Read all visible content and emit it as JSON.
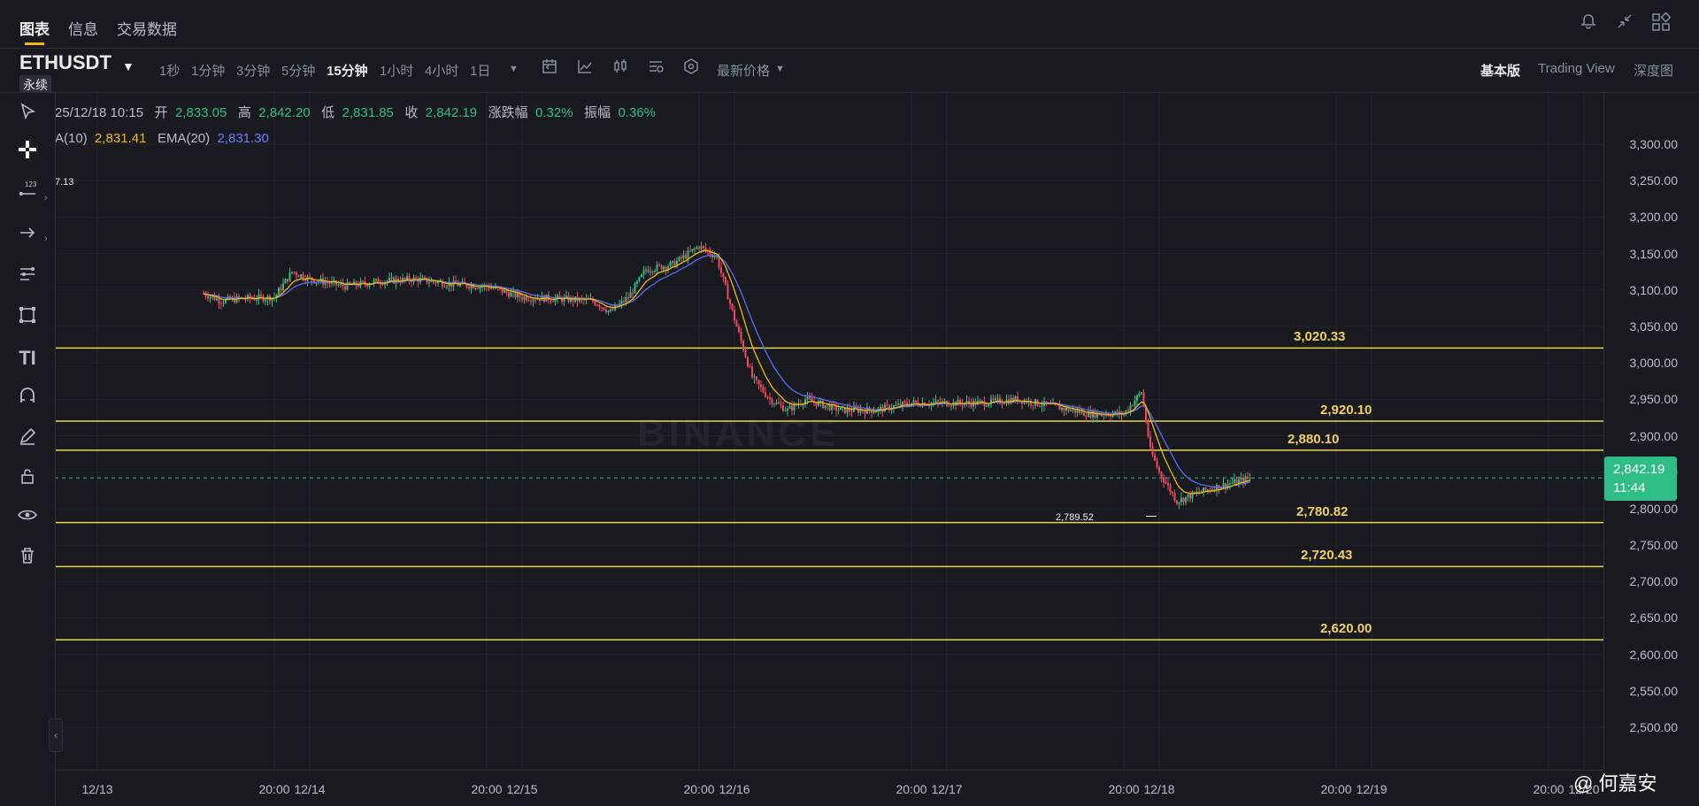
{
  "nav": {
    "tabs": [
      "图表",
      "信息",
      "交易数据"
    ],
    "icons": [
      "bell-icon",
      "collapse-arrows-icon",
      "grid-layout-icon"
    ]
  },
  "toolbar": {
    "symbol": "ETHUSDT",
    "badge": "永续",
    "intervals": [
      "1秒",
      "1分钟",
      "3分钟",
      "5分钟",
      "15分钟",
      "1小时",
      "4小时",
      "1日"
    ],
    "active_interval": "15分钟",
    "price_type": "最新价格",
    "versions": [
      "基本版",
      "Trading View",
      "深度图"
    ]
  },
  "ohlc": {
    "datetime": "25/12/18 10:15",
    "open_label": "开",
    "open": "2,833.05",
    "high_label": "高",
    "high": "2,842.20",
    "low_label": "低",
    "low": "2,831.85",
    "close_label": "收",
    "close": "2,842.19",
    "change_label": "涨跌幅",
    "change": "0.32%",
    "amp_label": "振幅",
    "amp": "0.36%"
  },
  "indicators": {
    "ema10_label": "A(10)",
    "ema10": "2,831.41",
    "ema20_label": "EMA(20)",
    "ema20": "2,831.30",
    "left_value": "7.13"
  },
  "watermark": "BINANCE",
  "price_tag": {
    "price": "2,842.19",
    "countdown": "11:44"
  },
  "credit": "@ 何嘉安",
  "colors": {
    "up": "#2ebd85",
    "down": "#f6465d",
    "accent": "#f0b90b",
    "ema10": "#f0b90b",
    "ema20": "#5b6cf0",
    "hline": "#e8d44d"
  },
  "chart_data": {
    "type": "candlestick",
    "symbol": "ETHUSDT",
    "interval": "15分钟",
    "ylim": [
      2450,
      3350
    ],
    "y_ticks": [
      "3,300.00",
      "3,250.00",
      "3,200.00",
      "3,150.00",
      "3,100.00",
      "3,050.00",
      "3,000.00",
      "2,950.00",
      "2,900.00",
      "2,850.00",
      "2,800.00",
      "2,750.00",
      "2,700.00",
      "2,650.00",
      "2,600.00",
      "2,550.00",
      "2,500.00"
    ],
    "x_ticks": [
      "12/13",
      "20:00",
      "12/14",
      "20:00",
      "12/15",
      "20:00",
      "12/16",
      "20:00",
      "12/17",
      "20:00",
      "12/18",
      "20:00",
      "12/19",
      "20:00",
      "12/20"
    ],
    "horizontal_lines": [
      {
        "value": 3020.33,
        "label": "3,020.33"
      },
      {
        "value": 2920.1,
        "label": "2,920.10"
      },
      {
        "value": 2880.1,
        "label": "2,880.10"
      },
      {
        "value": 2780.82,
        "label": "2,780.82"
      },
      {
        "value": 2720.43,
        "label": "2,720.43"
      },
      {
        "value": 2620.0,
        "label": "2,620.00"
      }
    ],
    "current_price": 2842.19,
    "low_marker": {
      "value": 2789.52,
      "label": "2,789.52"
    },
    "price_path": [
      {
        "t": "12/13 12:00",
        "p": 3095
      },
      {
        "t": "12/13 14:00",
        "p": 3085
      },
      {
        "t": "12/13 16:00",
        "p": 3088
      },
      {
        "t": "12/13 20:00",
        "p": 3090
      },
      {
        "t": "12/13 22:00",
        "p": 3125
      },
      {
        "t": "12/14 00:00",
        "p": 3115
      },
      {
        "t": "12/14 04:00",
        "p": 3105
      },
      {
        "t": "12/14 08:00",
        "p": 3112
      },
      {
        "t": "12/14 12:00",
        "p": 3115
      },
      {
        "t": "12/14 16:00",
        "p": 3108
      },
      {
        "t": "12/14 20:00",
        "p": 3105
      },
      {
        "t": "12/15 00:00",
        "p": 3090
      },
      {
        "t": "12/15 04:00",
        "p": 3088
      },
      {
        "t": "12/15 08:00",
        "p": 3085
      },
      {
        "t": "12/15 10:00",
        "p": 3070
      },
      {
        "t": "12/15 12:00",
        "p": 3090
      },
      {
        "t": "12/15 14:00",
        "p": 3128
      },
      {
        "t": "12/15 17:00",
        "p": 3135
      },
      {
        "t": "12/15 20:00",
        "p": 3160
      },
      {
        "t": "12/15 22:00",
        "p": 3145
      },
      {
        "t": "12/16 00:00",
        "p": 3060
      },
      {
        "t": "12/16 02:00",
        "p": 2980
      },
      {
        "t": "12/16 04:00",
        "p": 2950
      },
      {
        "t": "12/16 06:00",
        "p": 2935
      },
      {
        "t": "12/16 08:00",
        "p": 2950
      },
      {
        "t": "12/16 12:00",
        "p": 2935
      },
      {
        "t": "12/16 16:00",
        "p": 2935
      },
      {
        "t": "12/16 20:00",
        "p": 2945
      },
      {
        "t": "12/17 00:00",
        "p": 2945
      },
      {
        "t": "12/17 04:00",
        "p": 2945
      },
      {
        "t": "12/17 08:00",
        "p": 2950
      },
      {
        "t": "12/17 12:00",
        "p": 2940
      },
      {
        "t": "12/17 16:00",
        "p": 2930
      },
      {
        "t": "12/17 20:00",
        "p": 2930
      },
      {
        "t": "12/17 22:00",
        "p": 2960
      },
      {
        "t": "12/17 23:00",
        "p": 2880
      },
      {
        "t": "12/18 00:00",
        "p": 2850
      },
      {
        "t": "12/18 02:00",
        "p": 2810
      },
      {
        "t": "12/18 04:00",
        "p": 2820
      },
      {
        "t": "12/18 06:00",
        "p": 2828
      },
      {
        "t": "12/18 10:15",
        "p": 2842
      }
    ]
  }
}
